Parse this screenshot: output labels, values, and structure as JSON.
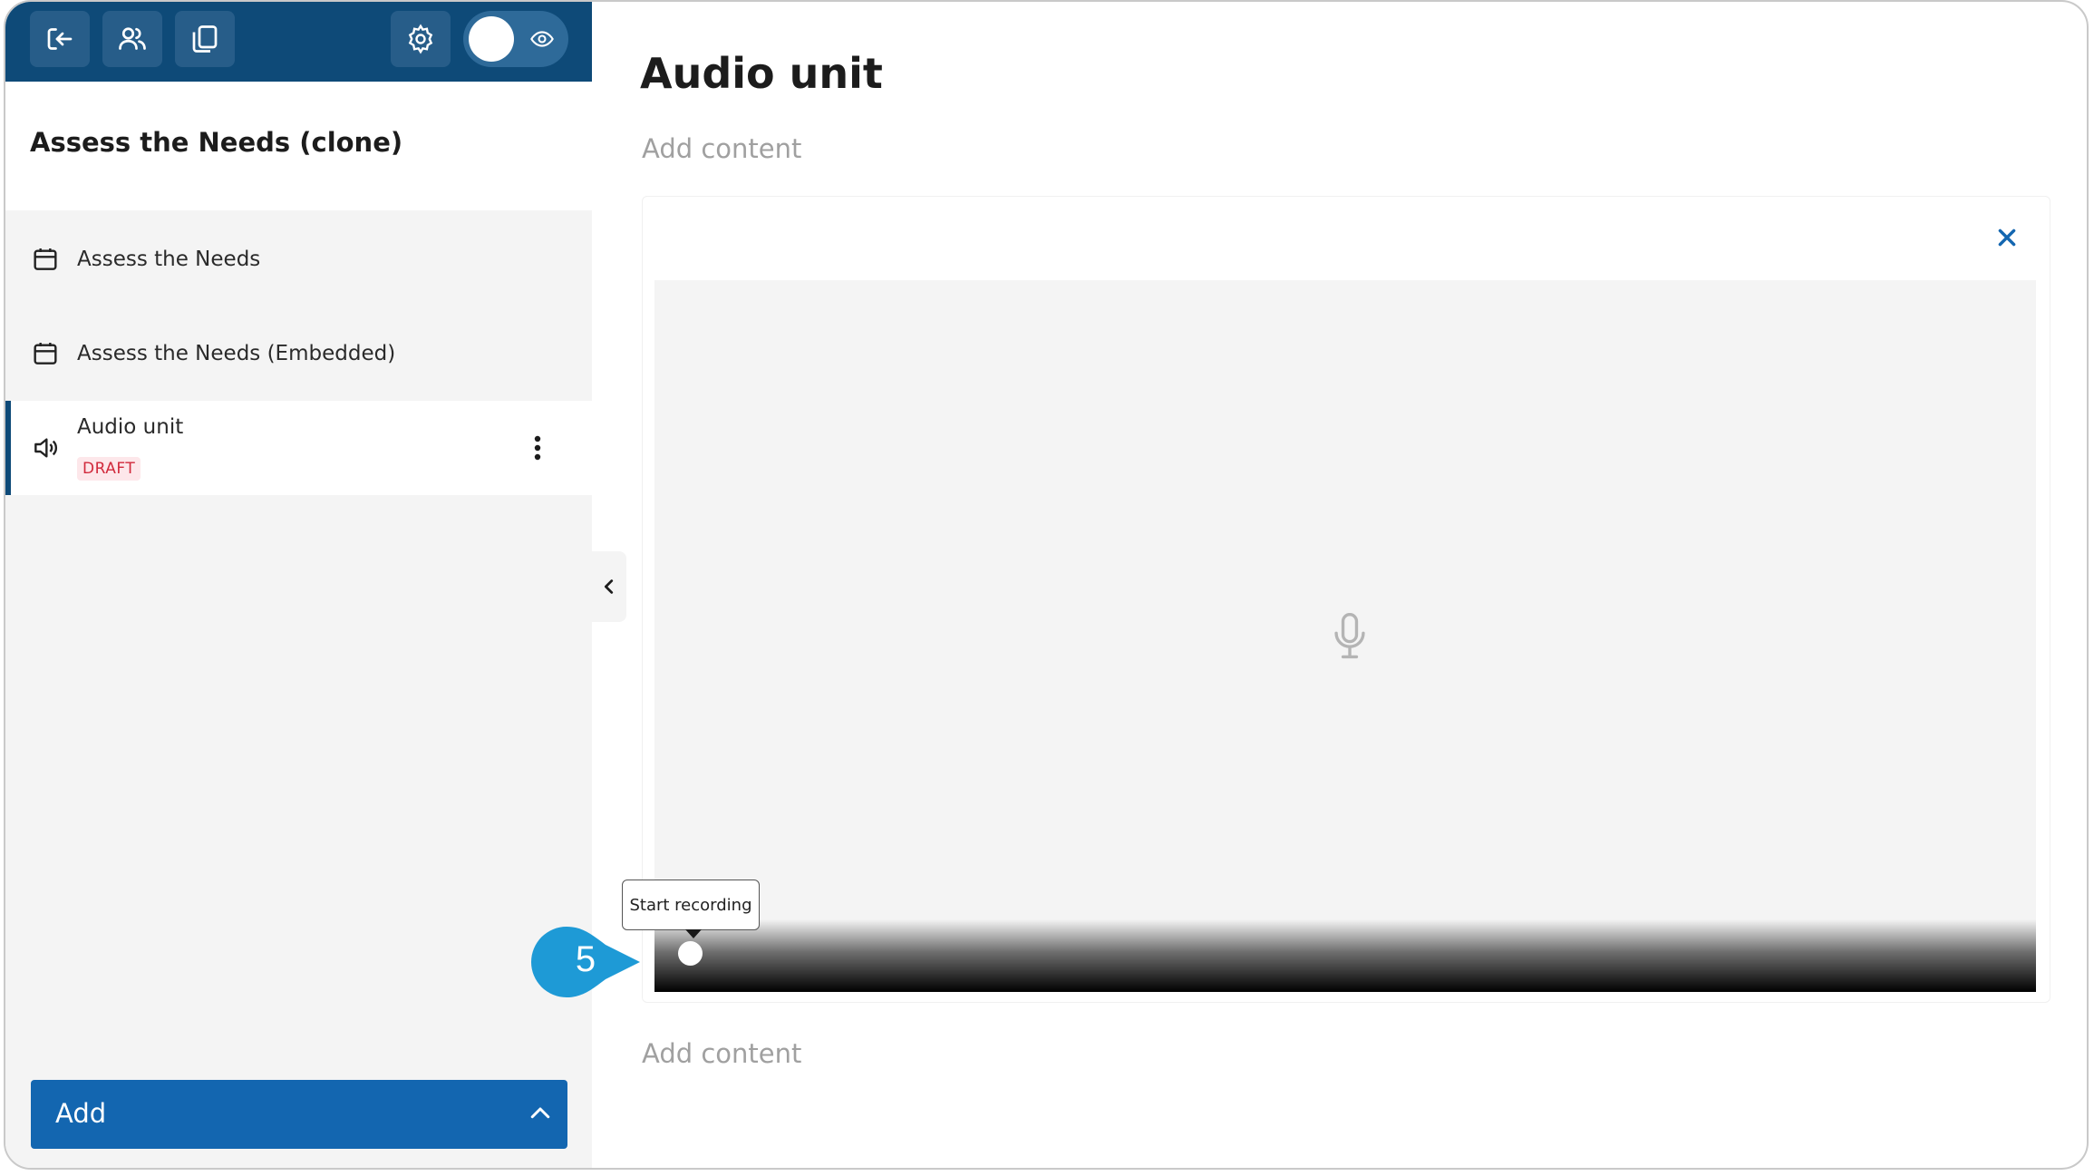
{
  "sidebar": {
    "course_title": "Assess the Needs (clone)",
    "items": [
      {
        "label": "Assess the Needs",
        "icon": "calendar-icon"
      },
      {
        "label": "Assess the Needs (Embedded)",
        "icon": "calendar-icon"
      },
      {
        "label": "Audio unit",
        "icon": "speaker-icon",
        "badge": "DRAFT",
        "active": true
      }
    ],
    "add_button_label": "Add"
  },
  "toolbar": {
    "icons": [
      "exit-icon",
      "users-icon",
      "copy-icon",
      "gear-icon",
      "eye-icon"
    ]
  },
  "main": {
    "title": "Audio unit",
    "add_content_top": "Add content",
    "add_content_bottom": "Add content",
    "recorder": {
      "tooltip": "Start recording"
    }
  },
  "annotation": {
    "step_number": "5"
  },
  "colors": {
    "brand": "#0e4a78",
    "accent": "#1366b0",
    "draft_badge": "#d12a3c",
    "callout": "#1e9ad6"
  }
}
